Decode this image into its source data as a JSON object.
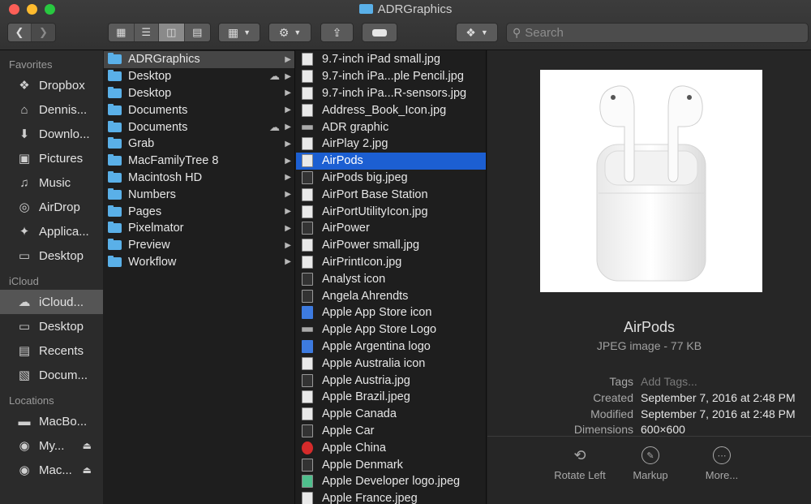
{
  "window": {
    "title": "ADRGraphics"
  },
  "toolbar": {
    "back_icon": "chevron-left-icon",
    "forward_icon": "chevron-right-icon",
    "view_modes": [
      "icon-view",
      "list-view",
      "column-view",
      "gallery-view"
    ],
    "active_view": "column-view",
    "search_placeholder": "Search"
  },
  "sidebar": {
    "favorites_label": "Favorites",
    "favorites": [
      {
        "label": "Dropbox",
        "icon": "dropbox-icon"
      },
      {
        "label": "Dennis...",
        "icon": "home-icon"
      },
      {
        "label": "Downlo...",
        "icon": "downloads-icon"
      },
      {
        "label": "Pictures",
        "icon": "camera-icon"
      },
      {
        "label": "Music",
        "icon": "music-icon"
      },
      {
        "label": "AirDrop",
        "icon": "airdrop-icon"
      },
      {
        "label": "Applica...",
        "icon": "applications-icon"
      },
      {
        "label": "Desktop",
        "icon": "desktop-icon"
      }
    ],
    "icloud_label": "iCloud",
    "icloud": [
      {
        "label": "iCloud...",
        "icon": "cloud-icon",
        "selected": true
      },
      {
        "label": "Desktop",
        "icon": "desktop-icon"
      },
      {
        "label": "Recents",
        "icon": "recents-icon"
      },
      {
        "label": "Docum...",
        "icon": "document-icon"
      }
    ],
    "locations_label": "Locations",
    "locations": [
      {
        "label": "MacBo...",
        "icon": "laptop-icon"
      },
      {
        "label": "My...",
        "icon": "disk-icon",
        "eject": true
      },
      {
        "label": "Mac...",
        "icon": "disk-icon",
        "eject": true
      }
    ]
  },
  "column1": {
    "items": [
      {
        "label": "ADRGraphics",
        "selected": true
      },
      {
        "label": "Desktop",
        "cloud": true
      },
      {
        "label": "Desktop"
      },
      {
        "label": "Documents"
      },
      {
        "label": "Documents",
        "cloud": true
      },
      {
        "label": "Grab"
      },
      {
        "label": "MacFamilyTree 8"
      },
      {
        "label": "Macintosh HD"
      },
      {
        "label": "Numbers"
      },
      {
        "label": "Pages"
      },
      {
        "label": "Pixelmator"
      },
      {
        "label": "Preview"
      },
      {
        "label": "Workflow"
      }
    ]
  },
  "column2": {
    "items": [
      {
        "label": "9.7-inch iPad small.jpg",
        "icon": "doc"
      },
      {
        "label": "9.7-inch iPa...ple Pencil.jpg",
        "icon": "doc"
      },
      {
        "label": "9.7-inch iPa...R-sensors.jpg",
        "icon": "doc"
      },
      {
        "label": "Address_Book_Icon.jpg",
        "icon": "doc"
      },
      {
        "label": "ADR graphic",
        "icon": "wide"
      },
      {
        "label": "AirPlay 2.jpg",
        "icon": "doc"
      },
      {
        "label": "AirPods",
        "icon": "doc",
        "selected": true
      },
      {
        "label": "AirPods big.jpeg",
        "icon": "dark"
      },
      {
        "label": "AirPort Base Station",
        "icon": "doc"
      },
      {
        "label": "AirPortUtilityIcon.jpg",
        "icon": "doc"
      },
      {
        "label": "AirPower",
        "icon": "dark"
      },
      {
        "label": "AirPower small.jpg",
        "icon": "doc"
      },
      {
        "label": "AirPrintIcon.jpg",
        "icon": "doc"
      },
      {
        "label": "Analyst icon",
        "icon": "dark"
      },
      {
        "label": "Angela Ahrendts",
        "icon": "dark"
      },
      {
        "label": "Apple App Store icon",
        "icon": "blue"
      },
      {
        "label": "Apple App Store Logo",
        "icon": "wide"
      },
      {
        "label": "Apple Argentina logo",
        "icon": "blue"
      },
      {
        "label": "Apple Australia icon",
        "icon": "doc"
      },
      {
        "label": "Apple Austria.jpg",
        "icon": "dark"
      },
      {
        "label": "Apple Brazil.jpeg",
        "icon": "doc"
      },
      {
        "label": "Apple Canada",
        "icon": "doc"
      },
      {
        "label": "Apple Car",
        "icon": "dark"
      },
      {
        "label": "Apple China",
        "icon": "red"
      },
      {
        "label": "Apple Denmark",
        "icon": "dark"
      },
      {
        "label": "Apple Developer logo.jpeg",
        "icon": "green"
      },
      {
        "label": "Apple France.jpeg",
        "icon": "doc"
      }
    ]
  },
  "preview": {
    "name": "AirPods",
    "kind": "JPEG image - 77 KB",
    "tags_label": "Tags",
    "tags_placeholder": "Add Tags...",
    "created_label": "Created",
    "created_value": "September 7, 2016 at 2:48 PM",
    "modified_label": "Modified",
    "modified_value": "September 7, 2016 at 2:48 PM",
    "dimensions_label": "Dimensions",
    "dimensions_value": "600×600",
    "actions": [
      {
        "label": "Rotate Left",
        "icon": "rotate-left-icon"
      },
      {
        "label": "Markup",
        "icon": "markup-icon"
      },
      {
        "label": "More...",
        "icon": "more-icon"
      }
    ]
  }
}
